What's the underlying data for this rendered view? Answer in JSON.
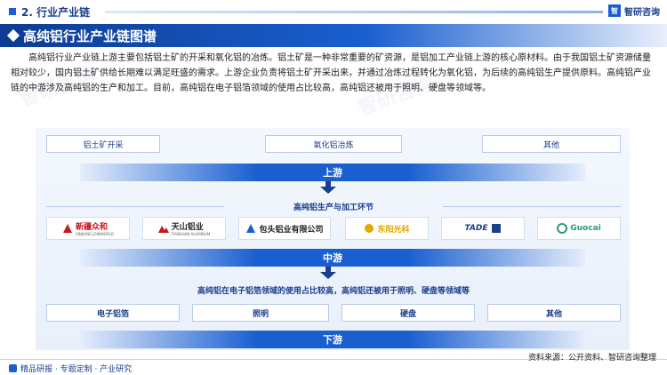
{
  "header": {
    "section_label": "2. 行业产业链",
    "logo_text": "智研咨询",
    "logo_mark": "智"
  },
  "title": "高纯铝行业产业链图谱",
  "intro": "高纯铝行业产业链上游主要包括铝土矿的开采和氧化铝的冶炼。铝土矿是一种非常重要的矿资源，是铝加工产业链上游的核心原材料。由于我国铝土矿资源储量相对较少，国内铝土矿供给长期难以满足旺盛的需求。上游企业负责将铝土矿开采出来，并通过冶炼过程转化为氧化铝，为后续的高纯铝生产提供原料。高纯铝产业链的中游涉及高纯铝的生产和加工。目前，高纯铝在电子铝箔领域的使用占比较高，高纯铝还被用于照明、硬盘等领域等。",
  "upstream": {
    "items": [
      "铝土矿开采",
      "氧化铝冶炼",
      "其他"
    ],
    "label": "上游"
  },
  "midstream": {
    "heading": "高纯铝生产与加工环节",
    "companies": [
      {
        "name": "新疆众和",
        "sub": "XINJIANG JOINWORLD",
        "icon": "joinworld-logo-icon",
        "color": "#c8161d"
      },
      {
        "name": "天山铝业",
        "sub": "TIANSHAN ALUMINUM",
        "icon": "tianshan-logo-icon",
        "color": "#c8161d"
      },
      {
        "name": "包头铝业有限公司",
        "sub": "",
        "icon": "baotou-logo-icon",
        "color": "#1a5fd0"
      },
      {
        "name": "东阳光科",
        "sub": "",
        "icon": "dongyangguang-logo-icon",
        "color": "#e0a800"
      },
      {
        "name": "TADE",
        "sub": "",
        "icon": "tade-logo-icon",
        "color": "#1a3f8c"
      },
      {
        "name": "Guocai",
        "sub": "",
        "icon": "guocai-logo-icon",
        "color": "#2b9a6b"
      }
    ],
    "label": "中游"
  },
  "downstream": {
    "heading": "高纯铝在电子铝箔领域的使用占比较高，高纯铝还被用于照明、硬盘等领域等",
    "items": [
      "电子铝箔",
      "照明",
      "硬盘",
      "其他"
    ],
    "label": "下游"
  },
  "footer": {
    "left_text": "精品研报 · 专题定制 · 产业研究",
    "source": "资料来源：公开资料、智研咨询整理"
  },
  "watermark_text": "智研咨询",
  "colors": {
    "primary": "#1a5fd0",
    "dark": "#0d3c91",
    "text_accent": "#1a3f8c"
  }
}
